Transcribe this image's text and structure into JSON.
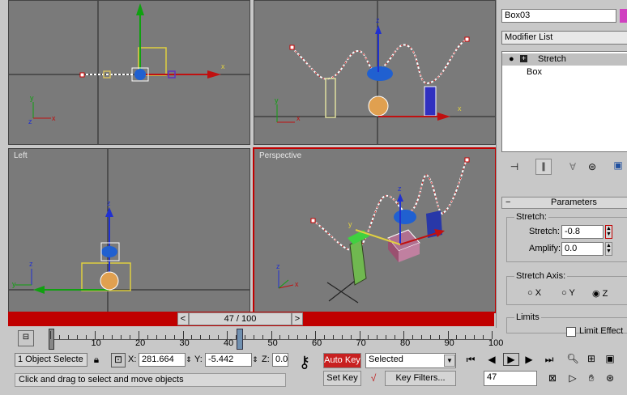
{
  "viewports": {
    "left_label": "Left",
    "perspective_label": "Perspective",
    "axis_x": "x",
    "axis_y": "y",
    "axis_z": "z"
  },
  "command_panel": {
    "object_name": "Box03",
    "modifier_list": "Modifier List",
    "stack_items": [
      "Stretch",
      "Box"
    ],
    "parameters_title": "Parameters",
    "stretch_group": "Stretch:",
    "stretch_label": "Stretch:",
    "stretch_value": "-0.8",
    "amplify_label": "Amplify:",
    "amplify_value": "0.0",
    "axis_group": "Stretch Axis:",
    "axis_x": "X",
    "axis_y": "Y",
    "axis_z": "Z",
    "axis_selected": "Z",
    "limits_group": "Limits",
    "limit_effect": "Limit Effect"
  },
  "timeline": {
    "frame_text": "47 / 100",
    "current_frame": 47,
    "total_frames": 100,
    "ticks": [
      "10",
      "20",
      "30",
      "40",
      "50",
      "60",
      "70",
      "80",
      "90",
      "100"
    ]
  },
  "status": {
    "selection": "1 Object Selecte",
    "x_label": "X:",
    "x_value": "281.664",
    "y_label": "Y:",
    "y_value": "-5.442",
    "z_label": "Z:",
    "z_value": "0.0",
    "auto_key": "Auto Key",
    "set_key": "Set Key",
    "selected_dropdown": "Selected",
    "key_filters": "Key Filters...",
    "frame_field": "47",
    "prompt": "Click and drag to select and move objects"
  },
  "colors": {
    "viewport_bg": "#7a7a7a",
    "active_border": "#c00000",
    "auto_key_bg": "#c82020",
    "track_bar": "#c00000"
  }
}
